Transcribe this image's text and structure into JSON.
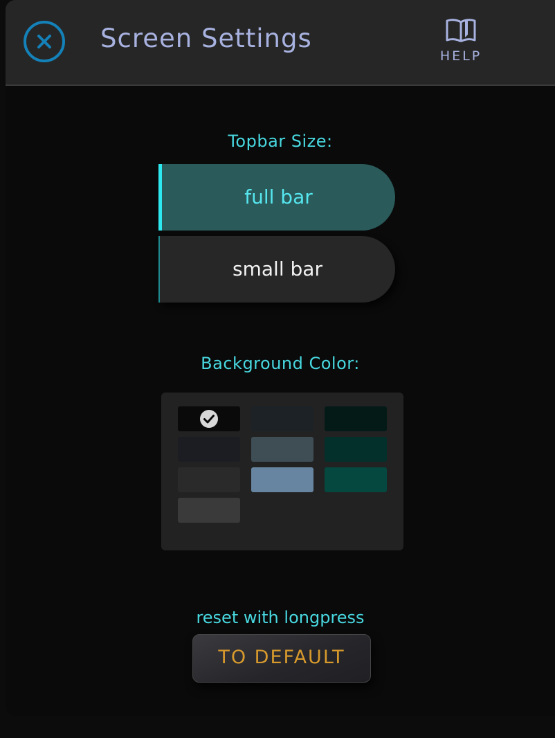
{
  "header": {
    "title": "Screen Settings",
    "close_icon": "close-circle-icon",
    "help_icon": "book-open-icon",
    "help_label": "HELP"
  },
  "topbar": {
    "label": "Topbar Size:",
    "options": [
      {
        "label": "full bar",
        "selected": true
      },
      {
        "label": "small bar",
        "selected": false
      }
    ]
  },
  "background": {
    "label": "Background Color:",
    "swatches": [
      {
        "color": "#0a0a0a",
        "selected": true
      },
      {
        "color": "#1d2227",
        "selected": false
      },
      {
        "color": "#041a17",
        "selected": false
      },
      {
        "color": "#1c1d22",
        "selected": false
      },
      {
        "color": "#3f4d55",
        "selected": false
      },
      {
        "color": "#04302b",
        "selected": false
      },
      {
        "color": "#2a2a2a",
        "selected": false
      },
      {
        "color": "#6785a0",
        "selected": false
      },
      {
        "color": "#044840",
        "selected": false
      },
      {
        "color": "#3a3a3a",
        "selected": false
      }
    ]
  },
  "reset": {
    "hint": "reset with longpress",
    "button_label": "TO DEFAULT"
  },
  "colors": {
    "accent": "#48d8e0",
    "title": "#a8b2e0",
    "close": "#1481b8",
    "reset_text": "#d89a2c"
  }
}
